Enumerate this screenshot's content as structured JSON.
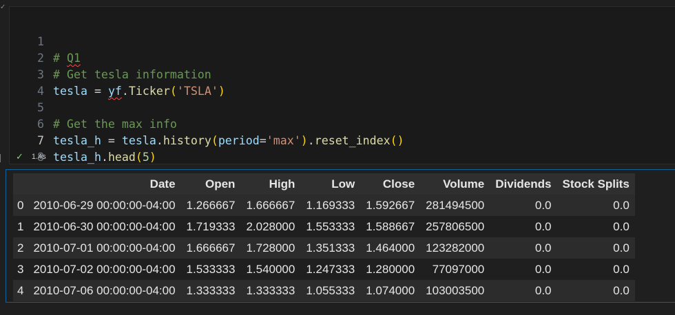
{
  "cell": {
    "lines": [
      {
        "num": "1"
      },
      {
        "num": "2"
      },
      {
        "num": "3"
      },
      {
        "num": "4"
      },
      {
        "num": "5"
      },
      {
        "num": "6"
      },
      {
        "num": "7"
      },
      {
        "num": "8"
      }
    ],
    "tokens": {
      "l1_hash": "# ",
      "l1_q1": "Q1",
      "l2": "# Get tesla information",
      "l3_var": "tesla",
      "l3_eq": " = ",
      "l3_mod": "yf",
      "l3_dot": ".",
      "l3_fn": "Ticker",
      "l3_op": "(",
      "l3_str": "'TSLA'",
      "l3_cp": ")",
      "l5": "# Get the max info",
      "l6_var": "tesla_h",
      "l6_eq": " = ",
      "l6_obj": "tesla",
      "l6_dot1": ".",
      "l6_fn1": "history",
      "l6_op1": "(",
      "l6_kw": "period",
      "l6_assign": "=",
      "l6_str": "'max'",
      "l6_cp1": ")",
      "l6_dot2": ".",
      "l6_fn2": "reset_index",
      "l6_par2": "()",
      "l7_var": "tesla_h",
      "l7_dot": ".",
      "l7_fn": "head",
      "l7_op": "(",
      "l7_num": "5",
      "l7_cp": ")"
    },
    "status": {
      "check": "✓",
      "time": "1.4s"
    },
    "gutter_mark": "✓"
  },
  "output": {
    "columns": [
      "",
      "Date",
      "Open",
      "High",
      "Low",
      "Close",
      "Volume",
      "Dividends",
      "Stock Splits"
    ],
    "rows": [
      [
        "0",
        "2010-06-29 00:00:00-04:00",
        "1.266667",
        "1.666667",
        "1.169333",
        "1.592667",
        "281494500",
        "0.0",
        "0.0"
      ],
      [
        "1",
        "2010-06-30 00:00:00-04:00",
        "1.719333",
        "2.028000",
        "1.553333",
        "1.588667",
        "257806500",
        "0.0",
        "0.0"
      ],
      [
        "2",
        "2010-07-01 00:00:00-04:00",
        "1.666667",
        "1.728000",
        "1.351333",
        "1.464000",
        "123282000",
        "0.0",
        "0.0"
      ],
      [
        "3",
        "2010-07-02 00:00:00-04:00",
        "1.533333",
        "1.540000",
        "1.247333",
        "1.280000",
        "77097000",
        "0.0",
        "0.0"
      ],
      [
        "4",
        "2010-07-06 00:00:00-04:00",
        "1.333333",
        "1.333333",
        "1.055333",
        "1.074000",
        "103003500",
        "0.0",
        "0.0"
      ]
    ]
  }
}
